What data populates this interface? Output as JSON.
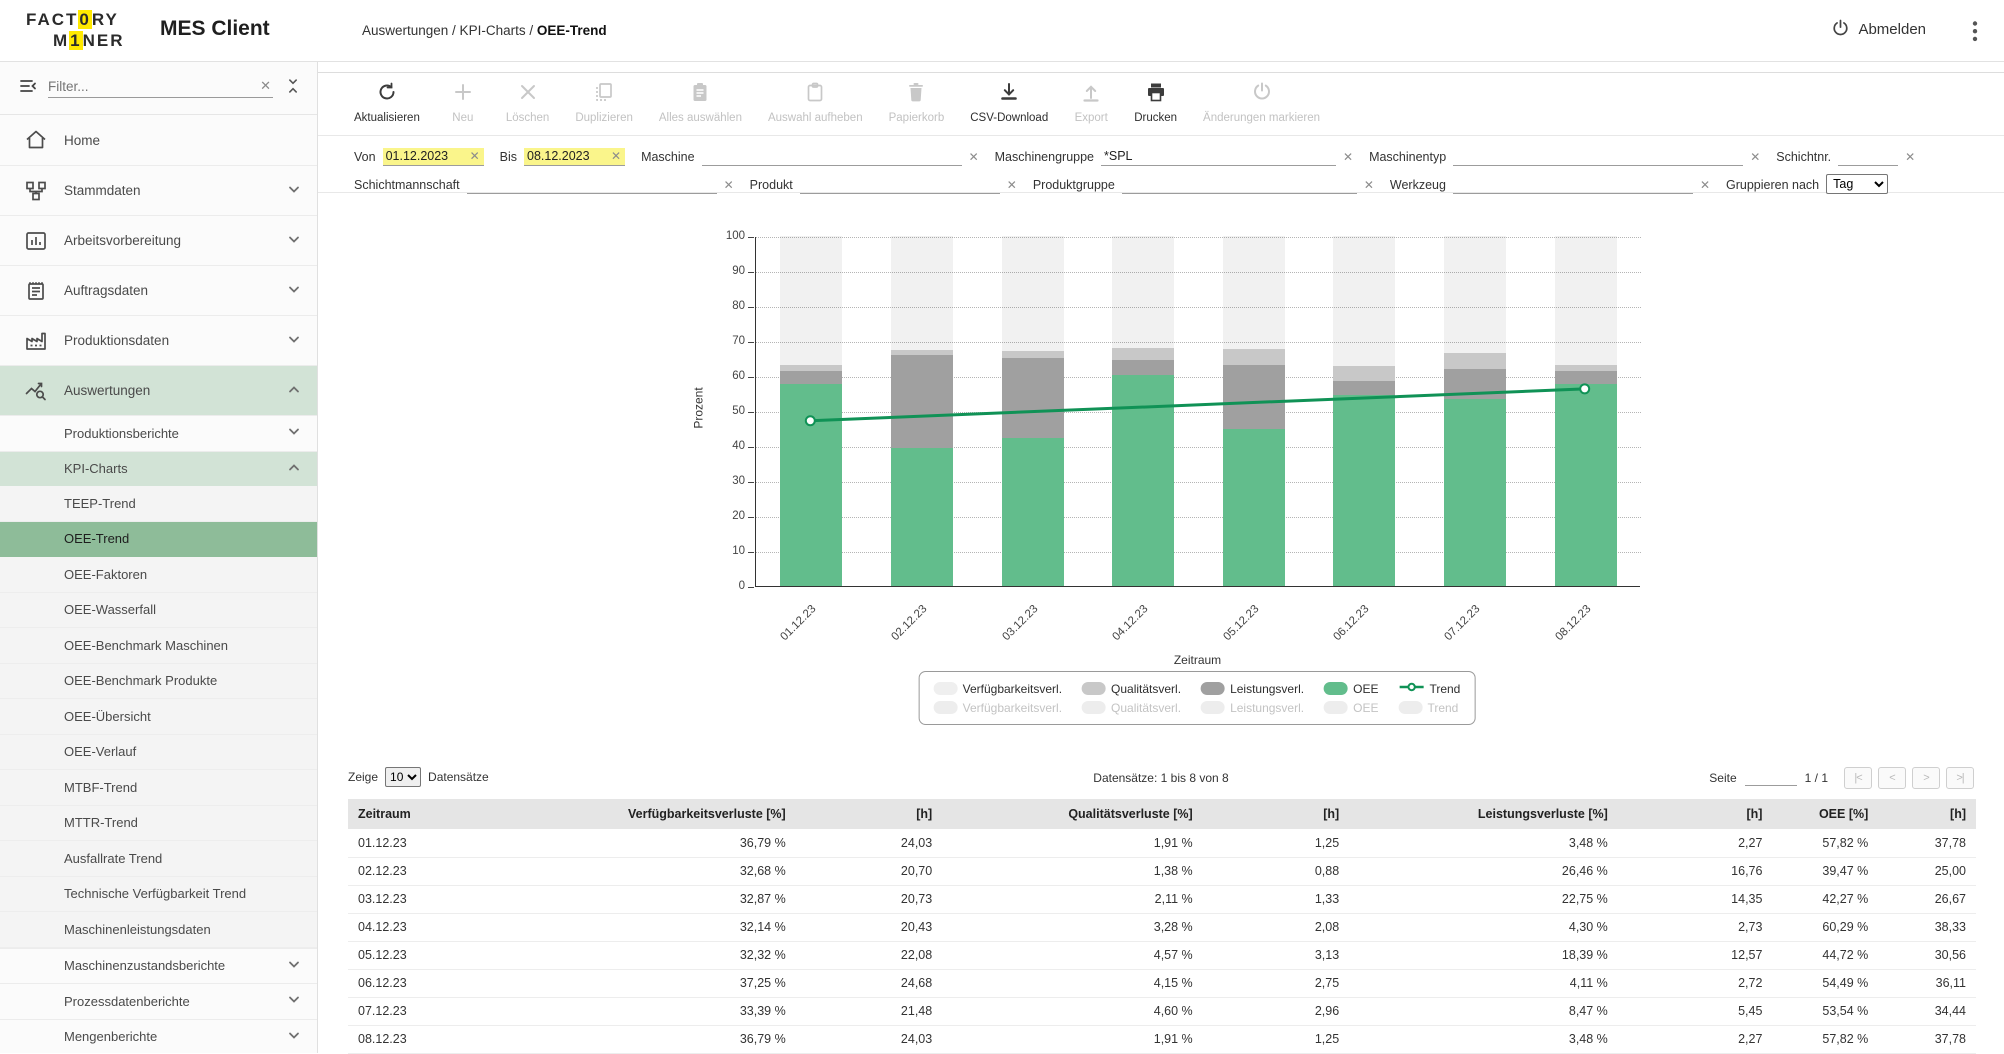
{
  "header": {
    "logo": {
      "l1_a": "FACT",
      "l1_hl": "0",
      "l1_b": "RY",
      "l2_a": "M",
      "l2_hl": "1",
      "l2_b": "NER"
    },
    "app_title": "MES Client",
    "breadcrumb_path": "Auswertungen / KPI-Charts / ",
    "breadcrumb_current": "OEE-Trend",
    "logout_label": "Abmelden"
  },
  "sidebar": {
    "filter_placeholder": "Filter...",
    "items": [
      {
        "label": "Home",
        "icon": "home-icon",
        "level": 0,
        "chevron": null,
        "state": "normal"
      },
      {
        "label": "Stammdaten",
        "icon": "stammdaten-icon",
        "level": 0,
        "chevron": "down",
        "state": "normal"
      },
      {
        "label": "Arbeitsvorbereitung",
        "icon": "arbeitsvorbereitung-icon",
        "level": 0,
        "chevron": "down",
        "state": "normal"
      },
      {
        "label": "Auftragsdaten",
        "icon": "auftragsdaten-icon",
        "level": 0,
        "chevron": "down",
        "state": "normal"
      },
      {
        "label": "Produktionsdaten",
        "icon": "produktionsdaten-icon",
        "level": 0,
        "chevron": "down",
        "state": "normal"
      },
      {
        "label": "Auswertungen",
        "icon": "auswertungen-icon",
        "level": 0,
        "chevron": "up",
        "state": "highlight"
      },
      {
        "label": "Produktionsberichte",
        "level": 1,
        "chevron": "down",
        "state": "normal"
      },
      {
        "label": "KPI-Charts",
        "level": 1,
        "chevron": "up",
        "state": "highlight"
      },
      {
        "label": "TEEP-Trend",
        "level": 2,
        "state": "normal"
      },
      {
        "label": "OEE-Trend",
        "level": 2,
        "state": "selected"
      },
      {
        "label": "OEE-Faktoren",
        "level": 2,
        "state": "normal"
      },
      {
        "label": "OEE-Wasserfall",
        "level": 2,
        "state": "normal"
      },
      {
        "label": "OEE-Benchmark Maschinen",
        "level": 2,
        "state": "normal"
      },
      {
        "label": "OEE-Benchmark Produkte",
        "level": 2,
        "state": "normal"
      },
      {
        "label": "OEE-Übersicht",
        "level": 2,
        "state": "normal"
      },
      {
        "label": "OEE-Verlauf",
        "level": 2,
        "state": "normal"
      },
      {
        "label": "MTBF-Trend",
        "level": 2,
        "state": "normal"
      },
      {
        "label": "MTTR-Trend",
        "level": 2,
        "state": "normal"
      },
      {
        "label": "Ausfallrate Trend",
        "level": 2,
        "state": "normal"
      },
      {
        "label": "Technische Verfügbarkeit Trend",
        "level": 2,
        "state": "normal"
      },
      {
        "label": "Maschinenleistungsdaten",
        "level": 2,
        "state": "normal"
      },
      {
        "label": "Maschinenzustandsberichte",
        "level": 1,
        "chevron": "down",
        "state": "normal"
      },
      {
        "label": "Prozessdatenberichte",
        "level": 1,
        "chevron": "down",
        "state": "normal"
      },
      {
        "label": "Mengenberichte",
        "level": 1,
        "chevron": "down",
        "state": "normal"
      }
    ]
  },
  "toolbar": {
    "buttons": [
      {
        "label": "Aktualisieren",
        "icon": "refresh-icon",
        "enabled": true
      },
      {
        "label": "Neu",
        "icon": "plus-icon",
        "enabled": false
      },
      {
        "label": "Löschen",
        "icon": "delete-icon",
        "enabled": false
      },
      {
        "label": "Duplizieren",
        "icon": "duplicate-icon",
        "enabled": false
      },
      {
        "label": "Alles auswählen",
        "icon": "select-all-icon",
        "enabled": false
      },
      {
        "label": "Auswahl aufheben",
        "icon": "deselect-icon",
        "enabled": false
      },
      {
        "label": "Papierkorb",
        "icon": "trash-icon",
        "enabled": false
      },
      {
        "label": "CSV-Download",
        "icon": "download-icon",
        "enabled": true
      },
      {
        "label": "Export",
        "icon": "export-icon",
        "enabled": false
      },
      {
        "label": "Drucken",
        "icon": "print-icon",
        "enabled": true
      },
      {
        "label": "Änderungen markieren",
        "icon": "mark-changes-icon",
        "enabled": false
      }
    ]
  },
  "filters": {
    "row1": [
      {
        "label": "Von",
        "value": "01.12.2023",
        "highlighted": true
      },
      {
        "label": "Bis",
        "value": "08.12.2023",
        "highlighted": true
      },
      {
        "label": "Maschine",
        "value": "",
        "highlighted": false
      },
      {
        "label": "Maschinengruppe",
        "value": "*SPL",
        "highlighted": false
      },
      {
        "label": "Maschinentyp",
        "value": "",
        "highlighted": false
      },
      {
        "label": "Schichtnr.",
        "value": "",
        "highlighted": false
      }
    ],
    "row2": [
      {
        "label": "Schichtmannschaft",
        "value": "",
        "highlighted": false
      },
      {
        "label": "Produkt",
        "value": "",
        "highlighted": false
      },
      {
        "label": "Produktgruppe",
        "value": "",
        "highlighted": false
      },
      {
        "label": "Werkzeug",
        "value": "",
        "highlighted": false
      }
    ],
    "group_by": {
      "label": "Gruppieren nach",
      "selected": "Tag"
    }
  },
  "chart_data": {
    "type": "bar",
    "stacked": true,
    "title": "",
    "xlabel": "Zeitraum",
    "ylabel": "Prozent",
    "ylim": [
      0,
      100
    ],
    "yticks": [
      0,
      10,
      20,
      30,
      40,
      50,
      60,
      70,
      80,
      90,
      100
    ],
    "grid": "dotted-horizontal",
    "legend_position": "bottom",
    "categories": [
      "01.12.23",
      "02.12.23",
      "03.12.23",
      "04.12.23",
      "05.12.23",
      "06.12.23",
      "07.12.23",
      "08.12.23"
    ],
    "series": [
      {
        "name": "OEE",
        "color": "#62bd8c",
        "values": [
          57.82,
          39.47,
          42.27,
          60.29,
          44.72,
          54.49,
          53.54,
          57.82
        ]
      },
      {
        "name": "Leistungsverl.",
        "color": "#a0a0a0",
        "values": [
          3.48,
          26.46,
          22.75,
          4.3,
          18.39,
          4.11,
          8.47,
          3.48
        ]
      },
      {
        "name": "Qualitätsverl.",
        "color": "#c8c8c8",
        "values": [
          1.91,
          1.38,
          2.11,
          3.28,
          4.57,
          4.15,
          4.6,
          1.91
        ]
      },
      {
        "name": "Verfügbarkeitsverl.",
        "color": "#efefef",
        "values": [
          36.79,
          32.68,
          32.87,
          32.14,
          32.32,
          37.25,
          33.39,
          36.79
        ]
      }
    ],
    "trend": {
      "name": "Trend",
      "color": "#109256",
      "start_value": 47.5,
      "end_value": 56.6
    }
  },
  "legend": {
    "active": [
      {
        "label": "Verfügbarkeitsverl.",
        "swatch": "#efefef"
      },
      {
        "label": "Qualitätsverl.",
        "swatch": "#c8c8c8"
      },
      {
        "label": "Leistungsverl.",
        "swatch": "#a0a0a0"
      },
      {
        "label": "OEE",
        "swatch": "#62bd8c"
      },
      {
        "label": "Trend",
        "swatch": "line"
      }
    ],
    "inactive": [
      {
        "label": "Verfügbarkeitsverl."
      },
      {
        "label": "Qualitätsverl."
      },
      {
        "label": "Leistungsverl."
      },
      {
        "label": "OEE"
      },
      {
        "label": "Trend"
      }
    ]
  },
  "pagination": {
    "zeige_label": "Zeige",
    "page_size": "10",
    "datensaetze_label": "Datensätze",
    "info": "Datensätze: 1 bis 8 von 8",
    "seite_label": "Seite",
    "page_value": "1 / 1",
    "pager": [
      {
        "name": "first-page",
        "glyph": "|<"
      },
      {
        "name": "prev-page",
        "glyph": "<"
      },
      {
        "name": "next-page",
        "glyph": ">"
      },
      {
        "name": "last-page",
        "glyph": ">|"
      }
    ]
  },
  "table": {
    "headers": [
      "Zeitraum",
      "Verfügbarkeitsverluste [%]",
      "[h]",
      "Qualitätsverluste [%]",
      "[h]",
      "Leistungsverluste [%]",
      "[h]",
      "OEE [%]",
      "[h]"
    ],
    "rows": [
      [
        "01.12.23",
        "36,79 %",
        "24,03",
        "1,91 %",
        "1,25",
        "3,48 %",
        "2,27",
        "57,82 %",
        "37,78"
      ],
      [
        "02.12.23",
        "32,68 %",
        "20,70",
        "1,38 %",
        "0,88",
        "26,46 %",
        "16,76",
        "39,47 %",
        "25,00"
      ],
      [
        "03.12.23",
        "32,87 %",
        "20,73",
        "2,11 %",
        "1,33",
        "22,75 %",
        "14,35",
        "42,27 %",
        "26,67"
      ],
      [
        "04.12.23",
        "32,14 %",
        "20,43",
        "3,28 %",
        "2,08",
        "4,30 %",
        "2,73",
        "60,29 %",
        "38,33"
      ],
      [
        "05.12.23",
        "32,32 %",
        "22,08",
        "4,57 %",
        "3,13",
        "18,39 %",
        "12,57",
        "44,72 %",
        "30,56"
      ],
      [
        "06.12.23",
        "37,25 %",
        "24,68",
        "4,15 %",
        "2,75",
        "4,11 %",
        "2,72",
        "54,49 %",
        "36,11"
      ],
      [
        "07.12.23",
        "33,39 %",
        "21,48",
        "4,60 %",
        "2,96",
        "8,47 %",
        "5,45",
        "53,54 %",
        "34,44"
      ],
      [
        "08.12.23",
        "36,79 %",
        "24,03",
        "1,91 %",
        "1,25",
        "3,48 %",
        "2,27",
        "57,82 %",
        "37,78"
      ]
    ]
  }
}
